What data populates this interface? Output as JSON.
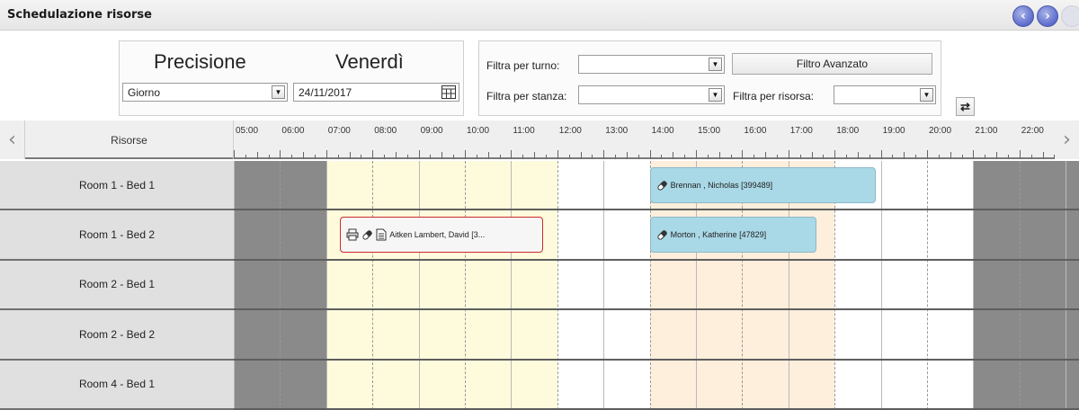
{
  "window": {
    "title": "Schedulazione risorse"
  },
  "nav": {
    "prev_icon": "‹",
    "next_icon": "›"
  },
  "precision_panel": {
    "precision_label": "Precisione",
    "day_label": "Venerdì",
    "precision_value": "Giorno",
    "date_value": "24/11/2017"
  },
  "filters": {
    "shift_label": "Filtra per turno:",
    "shift_value": "",
    "room_label": "Filtra per stanza:",
    "room_value": "",
    "resource_label": "Filtra per risorsa:",
    "resource_value": "",
    "advanced_button": "Filtro Avanzato"
  },
  "grid": {
    "resources_header": "Risorse",
    "hours": [
      "05:00",
      "06:00",
      "07:00",
      "08:00",
      "09:00",
      "10:00",
      "11:00",
      "12:00",
      "13:00",
      "14:00",
      "15:00",
      "16:00",
      "17:00",
      "18:00",
      "19:00",
      "20:00",
      "21:00",
      "22:00"
    ],
    "rows": [
      {
        "label": "Room 1 - Bed 1"
      },
      {
        "label": "Room 1 - Bed 2"
      },
      {
        "label": "Room 2 - Bed 1"
      },
      {
        "label": "Room 2 - Bed 2"
      },
      {
        "label": "Room 4 - Bed 1"
      }
    ],
    "events": [
      {
        "text": "Brennan , Nicholas [399489]",
        "row": 0,
        "style": "blue"
      },
      {
        "text": "Aitken Lambert, David [3...",
        "row": 1,
        "style": "white"
      },
      {
        "text": "Morton , Katherine [47829]",
        "row": 1,
        "style": "blue"
      }
    ],
    "colors": {
      "unavailable": "#8a8a8a",
      "morning_shift": "#fefbdc",
      "afternoon_shift": "#fdefdc",
      "event_blue": "#a9d8e6",
      "event_alert_border": "#cc2b2b"
    }
  }
}
